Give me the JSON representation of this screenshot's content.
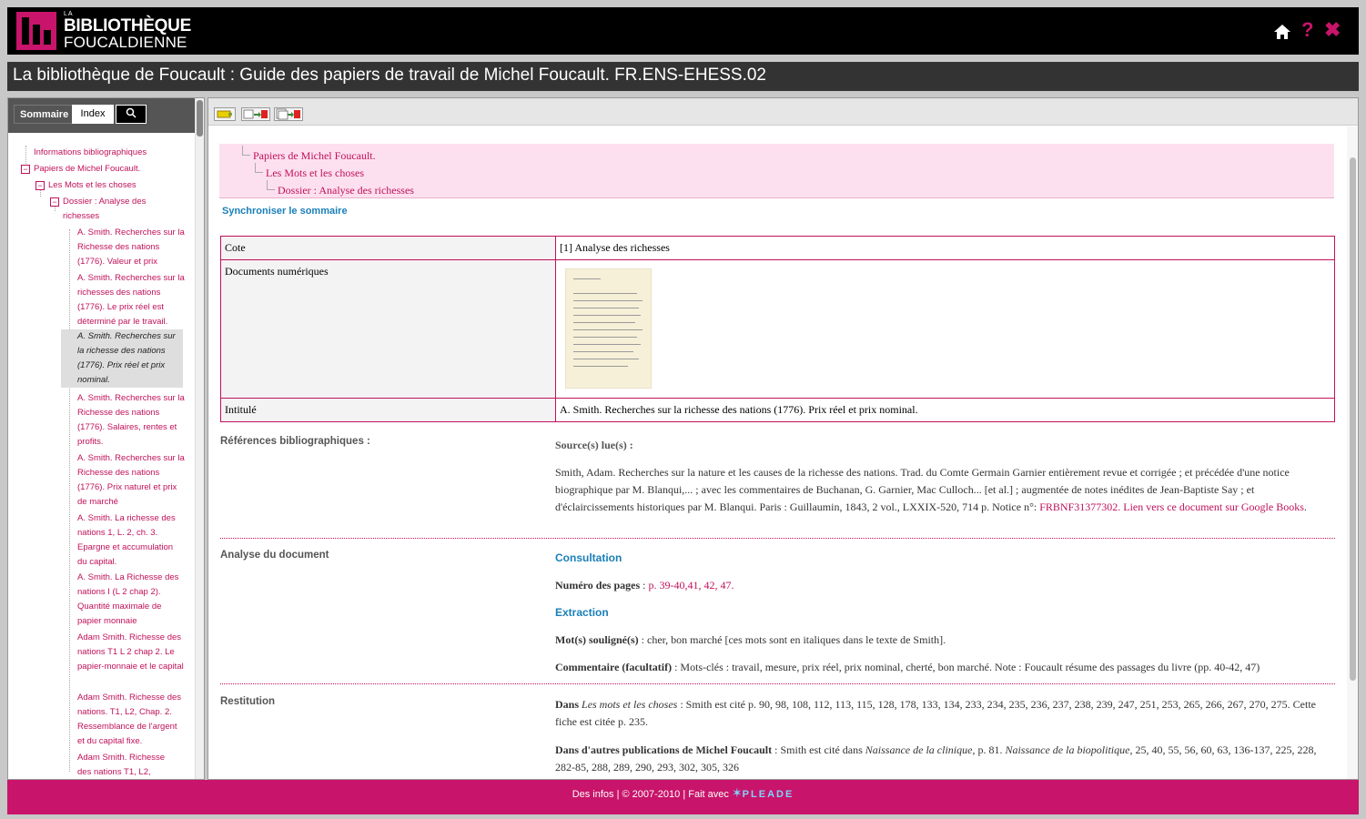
{
  "header": {
    "logo_small": "LA",
    "logo_line1": "BIBLIOTHÈQUE",
    "logo_line2": "FOUCALDIENNE",
    "home_icon": "home-icon",
    "help_icon": "help-icon",
    "close_icon": "close-icon",
    "help_glyph": "?",
    "close_glyph": "✖"
  },
  "title": "La bibliothèque de Foucault : Guide des papiers de travail de Michel Foucault. FR.ENS-EHESS.02",
  "sidebar": {
    "tab_sommaire": "Sommaire",
    "tab_index": "Index",
    "search_icon": "search-icon",
    "tree": [
      "Informations bibliographiques",
      "Papiers de Michel Foucault.",
      "Les Mots et les choses",
      "Dossier : Analyse des richesses",
      "A. Smith. Recherches sur la Richesse des nations (1776). Valeur et prix",
      "A. Smith. Recherches sur la richesses des nations (1776). Le prix réel est déterminé par le travail.",
      "A. Smith. Recherches sur la richesse des nations (1776). Prix réel et prix nominal.",
      "A. Smith. Recherches sur la Richesse des nations (1776). Salaires, rentes et profits.",
      "A. Smith. Recherches sur la Richesse des nations (1776). Prix naturel et prix de marché",
      "A. Smith. La richesse des nations 1, L. 2, ch. 3. Epargne et accumulation du capital.",
      "A. Smith. La Richesse des nations I (L 2 chap 2). Quantité maximale de papier monnaie",
      "Adam Smith. Richesse des nations T1 L 2 chap 2. Le papier-monnaie et le capital",
      "Adam Smith. Richesse des nations. T1, L2, Chap. 2. Ressemblance de l'argent et du capital fixe.",
      "Adam Smith. Richesse des nations T1, L2,"
    ]
  },
  "breadcrumb": {
    "l1": "Papiers de Michel Foucault.",
    "l2": "Les Mots et les choses",
    "l3": "Dossier : Analyse des richesses"
  },
  "sync_link": "Synchroniser le sommaire",
  "meta": {
    "cote_label": "Cote",
    "cote_value": "[1] Analyse des richesses",
    "docs_label": "Documents numériques",
    "intitule_label": "Intitulé",
    "intitule_value": "A. Smith. Recherches sur la richesse des nations (1776). Prix réel et prix nominal."
  },
  "references": {
    "label": "Références bibliographiques :",
    "source_label": "Source(s) lue(s) :",
    "text": "Smith, Adam. Recherches sur la nature et les causes de la richesse des nations. Trad. du Comte Germain Garnier entièrement revue et corrigée ; et précédée d'une notice biographique par M. Blanqui,... ; avec les commentaires de Buchanan, G. Garnier, Mac Culloch... [et al.] ; augmentée de notes inédites de Jean-Baptiste Say ; et d'éclaircissements historiques par M. Blanqui. Paris : Guillaumin, 1843, 2 vol., LXXIX-520, 714 p. Notice n°:",
    "notice_link": "FRBNF31377302",
    "google_link": "Lien vers ce document sur Google Books",
    "end": "."
  },
  "analyse": {
    "label": "Analyse du document",
    "consultation": "Consultation",
    "pages_label": "Numéro des pages",
    "pages_sep": " : ",
    "pages_value": "p. 39-40,41, 42, 47.",
    "extraction": "Extraction",
    "mots_label": "Mot(s) souligné(s)",
    "mots_value": " : cher, bon marché [ces mots sont en italiques dans le texte de Smith].",
    "comment_label": "Commentaire (facultatif)",
    "comment_value": " : Mots-clés : travail, mesure, prix réel, prix nominal, cherté, bon marché. Note : Foucault résume des passages du livre (pp. 40-42, 47)"
  },
  "restitution": {
    "label": "Restitution",
    "dans": "Dans",
    "book1": "Les mots et les choses",
    "text1": " : Smith est cité p. 90, 98, 108, 112, 113, 115, 128, 178, 133, 134, 233, 234, 235, 236, 237, 238, 239, 247, 251, 253, 265, 266, 267, 270, 275. Cette fiche est citée p. 235.",
    "autres_label": "Dans d'autres publications de Michel Foucault",
    "text2a": " : Smith est cité dans ",
    "book2": "Naissance de la clinique",
    "text2b": ", p. 81. ",
    "book3": "Naissance de la biopolitique",
    "text2c": ", 25, 40, 55, 56, 60, 63, 136-137, 225, 228, 282-85, 288, 289, 290, 293, 302, 305, 326"
  },
  "footer": {
    "text": "Des infos | © 2007-2010 | Fait avec",
    "brand": "PLEADE"
  },
  "colors": {
    "brand": "#c8146a",
    "link": "#c0115a",
    "accent": "#1a7fb8"
  }
}
